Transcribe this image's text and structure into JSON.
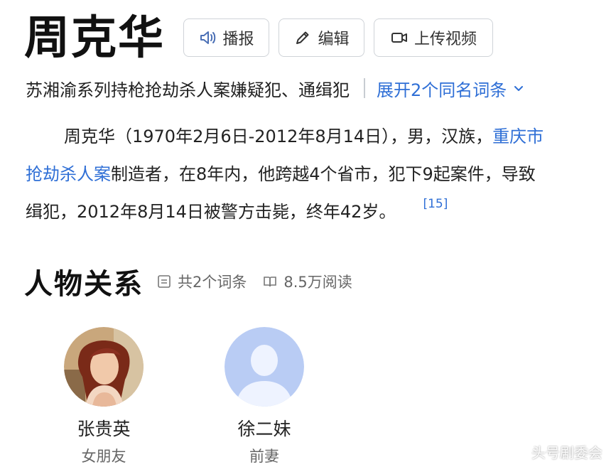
{
  "header": {
    "title": "周克华",
    "buttons": {
      "broadcast": "播报",
      "edit": "编辑",
      "upload_video": "上传视频"
    }
  },
  "subtitle": {
    "text": "苏湘渝系列持枪抢劫杀人案嫌疑犯、通缉犯",
    "expand": "展开2个同名词条"
  },
  "intro": {
    "l1_text": "周克华（1970年2月6日-2012年8月14日），男，汉族，",
    "l1_link": "重庆市",
    "l2_link": "抢劫杀人案",
    "l2_text": "制造者，在8年内，他跨越4个省市，犯下9起案件，导致",
    "l3_text": "缉犯，2012年8月14日被警方击毙，终年42岁。",
    "citation": "[15]"
  },
  "relations": {
    "heading": "人物关系",
    "entries": "共2个词条",
    "views": "8.5万阅读",
    "people": [
      {
        "name": "张贵英",
        "role": "女朋友",
        "avatar": "photo"
      },
      {
        "name": "徐二妹",
        "role": "前妻",
        "avatar": "default-person-icon"
      }
    ]
  },
  "watermark": "头号剧委会",
  "colors": {
    "link": "#2f6fd6",
    "text": "#222222",
    "muted": "#666666"
  }
}
